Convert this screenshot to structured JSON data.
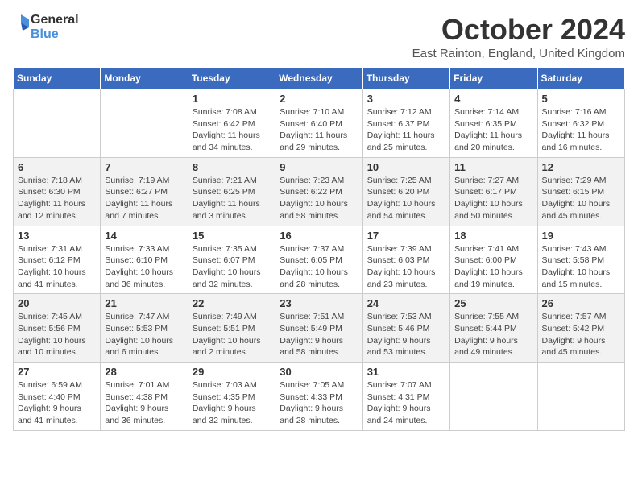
{
  "header": {
    "logo_line1": "General",
    "logo_line2": "Blue",
    "month": "October 2024",
    "location": "East Rainton, England, United Kingdom"
  },
  "days_of_week": [
    "Sunday",
    "Monday",
    "Tuesday",
    "Wednesday",
    "Thursday",
    "Friday",
    "Saturday"
  ],
  "weeks": [
    [
      {
        "day": "",
        "info": ""
      },
      {
        "day": "",
        "info": ""
      },
      {
        "day": "1",
        "info": "Sunrise: 7:08 AM\nSunset: 6:42 PM\nDaylight: 11 hours and 34 minutes."
      },
      {
        "day": "2",
        "info": "Sunrise: 7:10 AM\nSunset: 6:40 PM\nDaylight: 11 hours and 29 minutes."
      },
      {
        "day": "3",
        "info": "Sunrise: 7:12 AM\nSunset: 6:37 PM\nDaylight: 11 hours and 25 minutes."
      },
      {
        "day": "4",
        "info": "Sunrise: 7:14 AM\nSunset: 6:35 PM\nDaylight: 11 hours and 20 minutes."
      },
      {
        "day": "5",
        "info": "Sunrise: 7:16 AM\nSunset: 6:32 PM\nDaylight: 11 hours and 16 minutes."
      }
    ],
    [
      {
        "day": "6",
        "info": "Sunrise: 7:18 AM\nSunset: 6:30 PM\nDaylight: 11 hours and 12 minutes."
      },
      {
        "day": "7",
        "info": "Sunrise: 7:19 AM\nSunset: 6:27 PM\nDaylight: 11 hours and 7 minutes."
      },
      {
        "day": "8",
        "info": "Sunrise: 7:21 AM\nSunset: 6:25 PM\nDaylight: 11 hours and 3 minutes."
      },
      {
        "day": "9",
        "info": "Sunrise: 7:23 AM\nSunset: 6:22 PM\nDaylight: 10 hours and 58 minutes."
      },
      {
        "day": "10",
        "info": "Sunrise: 7:25 AM\nSunset: 6:20 PM\nDaylight: 10 hours and 54 minutes."
      },
      {
        "day": "11",
        "info": "Sunrise: 7:27 AM\nSunset: 6:17 PM\nDaylight: 10 hours and 50 minutes."
      },
      {
        "day": "12",
        "info": "Sunrise: 7:29 AM\nSunset: 6:15 PM\nDaylight: 10 hours and 45 minutes."
      }
    ],
    [
      {
        "day": "13",
        "info": "Sunrise: 7:31 AM\nSunset: 6:12 PM\nDaylight: 10 hours and 41 minutes."
      },
      {
        "day": "14",
        "info": "Sunrise: 7:33 AM\nSunset: 6:10 PM\nDaylight: 10 hours and 36 minutes."
      },
      {
        "day": "15",
        "info": "Sunrise: 7:35 AM\nSunset: 6:07 PM\nDaylight: 10 hours and 32 minutes."
      },
      {
        "day": "16",
        "info": "Sunrise: 7:37 AM\nSunset: 6:05 PM\nDaylight: 10 hours and 28 minutes."
      },
      {
        "day": "17",
        "info": "Sunrise: 7:39 AM\nSunset: 6:03 PM\nDaylight: 10 hours and 23 minutes."
      },
      {
        "day": "18",
        "info": "Sunrise: 7:41 AM\nSunset: 6:00 PM\nDaylight: 10 hours and 19 minutes."
      },
      {
        "day": "19",
        "info": "Sunrise: 7:43 AM\nSunset: 5:58 PM\nDaylight: 10 hours and 15 minutes."
      }
    ],
    [
      {
        "day": "20",
        "info": "Sunrise: 7:45 AM\nSunset: 5:56 PM\nDaylight: 10 hours and 10 minutes."
      },
      {
        "day": "21",
        "info": "Sunrise: 7:47 AM\nSunset: 5:53 PM\nDaylight: 10 hours and 6 minutes."
      },
      {
        "day": "22",
        "info": "Sunrise: 7:49 AM\nSunset: 5:51 PM\nDaylight: 10 hours and 2 minutes."
      },
      {
        "day": "23",
        "info": "Sunrise: 7:51 AM\nSunset: 5:49 PM\nDaylight: 9 hours and 58 minutes."
      },
      {
        "day": "24",
        "info": "Sunrise: 7:53 AM\nSunset: 5:46 PM\nDaylight: 9 hours and 53 minutes."
      },
      {
        "day": "25",
        "info": "Sunrise: 7:55 AM\nSunset: 5:44 PM\nDaylight: 9 hours and 49 minutes."
      },
      {
        "day": "26",
        "info": "Sunrise: 7:57 AM\nSunset: 5:42 PM\nDaylight: 9 hours and 45 minutes."
      }
    ],
    [
      {
        "day": "27",
        "info": "Sunrise: 6:59 AM\nSunset: 4:40 PM\nDaylight: 9 hours and 41 minutes."
      },
      {
        "day": "28",
        "info": "Sunrise: 7:01 AM\nSunset: 4:38 PM\nDaylight: 9 hours and 36 minutes."
      },
      {
        "day": "29",
        "info": "Sunrise: 7:03 AM\nSunset: 4:35 PM\nDaylight: 9 hours and 32 minutes."
      },
      {
        "day": "30",
        "info": "Sunrise: 7:05 AM\nSunset: 4:33 PM\nDaylight: 9 hours and 28 minutes."
      },
      {
        "day": "31",
        "info": "Sunrise: 7:07 AM\nSunset: 4:31 PM\nDaylight: 9 hours and 24 minutes."
      },
      {
        "day": "",
        "info": ""
      },
      {
        "day": "",
        "info": ""
      }
    ]
  ]
}
